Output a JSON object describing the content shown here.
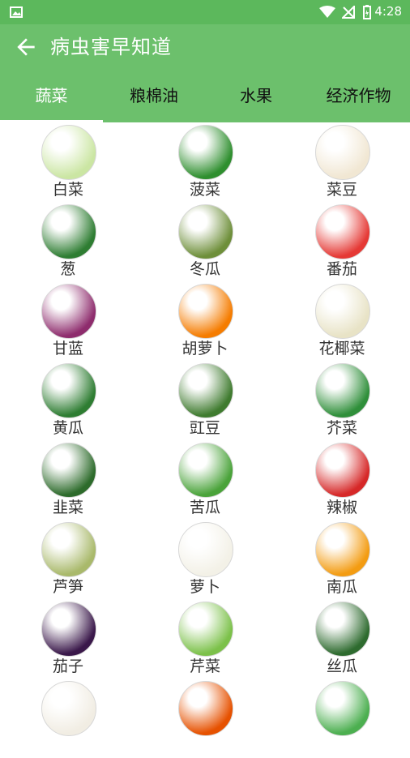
{
  "status": {
    "time": "4:28"
  },
  "header": {
    "title": "病虫害早知道"
  },
  "tabs": [
    {
      "label": "蔬菜",
      "active": true
    },
    {
      "label": "粮棉油",
      "active": false
    },
    {
      "label": "水果",
      "active": false
    },
    {
      "label": "经济作物",
      "active": false
    }
  ],
  "items": [
    {
      "label": "白菜",
      "icon": "cabbage-icon",
      "color": "#cbe6a3"
    },
    {
      "label": "菠菜",
      "icon": "spinach-icon",
      "color": "#2f8f2f"
    },
    {
      "label": "菜豆",
      "icon": "bean-icon",
      "color": "#f1e7d3"
    },
    {
      "label": "葱",
      "icon": "scallion-icon",
      "color": "#2e7d32"
    },
    {
      "label": "冬瓜",
      "icon": "wax-gourd-icon",
      "color": "#6e8f3a"
    },
    {
      "label": "番茄",
      "icon": "tomato-icon",
      "color": "#e53935"
    },
    {
      "label": "甘蓝",
      "icon": "red-cabbage-icon",
      "color": "#8e2c6d"
    },
    {
      "label": "胡萝卜",
      "icon": "carrot-icon",
      "color": "#f57c00"
    },
    {
      "label": "花椰菜",
      "icon": "cauliflower-icon",
      "color": "#e8e3c6"
    },
    {
      "label": "黄瓜",
      "icon": "cucumber-icon",
      "color": "#2e7d32"
    },
    {
      "label": "豇豆",
      "icon": "cowpea-icon",
      "color": "#3f7b2f"
    },
    {
      "label": "芥菜",
      "icon": "mustard-greens-icon",
      "color": "#2f8f3a"
    },
    {
      "label": "韭菜",
      "icon": "chives-icon",
      "color": "#2d6b2b"
    },
    {
      "label": "苦瓜",
      "icon": "bitter-melon-icon",
      "color": "#4aa33a"
    },
    {
      "label": "辣椒",
      "icon": "chili-icon",
      "color": "#d62828"
    },
    {
      "label": "芦笋",
      "icon": "asparagus-icon",
      "color": "#a9b96b"
    },
    {
      "label": "萝卜",
      "icon": "radish-icon",
      "color": "#f3f1e7"
    },
    {
      "label": "南瓜",
      "icon": "pumpkin-icon",
      "color": "#f39c12"
    },
    {
      "label": "茄子",
      "icon": "eggplant-icon",
      "color": "#3a184a"
    },
    {
      "label": "芹菜",
      "icon": "celery-icon",
      "color": "#7cc14a"
    },
    {
      "label": "丝瓜",
      "icon": "loofah-icon",
      "color": "#2e6b2f"
    },
    {
      "label": "",
      "icon": "garlic-icon",
      "color": "#f1ede3"
    },
    {
      "label": "",
      "icon": "bell-pepper-icon",
      "color": "#e65100"
    },
    {
      "label": "",
      "icon": "peas-icon",
      "color": "#4caf50"
    }
  ]
}
